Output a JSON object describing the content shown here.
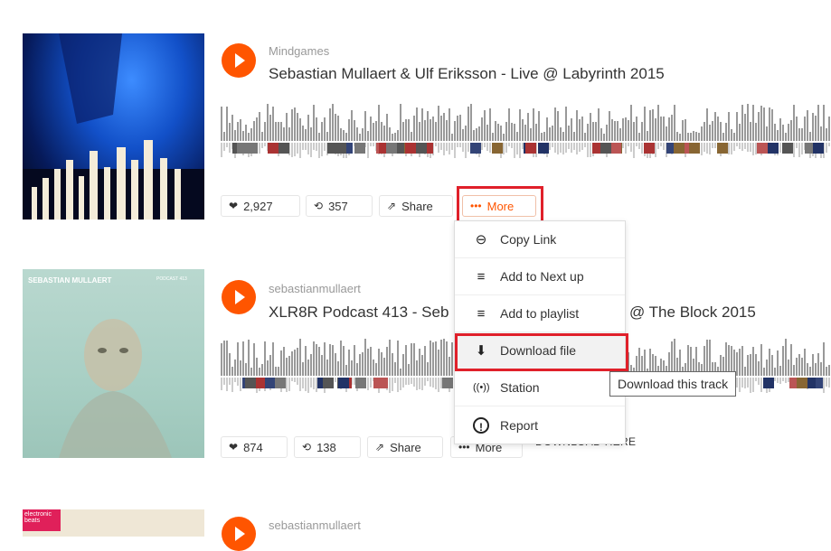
{
  "tracks": [
    {
      "user": "Mindgames",
      "title": "Sebastian Mullaert & Ulf Eriksson - Live @ Labyrinth 2015",
      "likes": "2,927",
      "reposts": "357",
      "share_label": "Share",
      "more_label": "More"
    },
    {
      "user": "sebastianmullaert",
      "title": "XLR8R Podcast 413 - Seb",
      "title_tail": "@ The Block 2015",
      "art_label": "SEBASTIAN MULLAERT",
      "art_badge": "PODCAST 413",
      "likes": "874",
      "reposts": "138",
      "share_label": "Share",
      "more_label": "More",
      "download_text": "DOWNLOAD HERE"
    },
    {
      "user": "sebastianmullaert",
      "art_label": "electronic beats"
    }
  ],
  "menu": {
    "items": [
      {
        "label": "Copy Link",
        "icon": "link-icon"
      },
      {
        "label": "Add to Next up",
        "icon": "add-next-icon"
      },
      {
        "label": "Add to playlist",
        "icon": "add-playlist-icon"
      },
      {
        "label": "Download file",
        "icon": "download-icon"
      },
      {
        "label": "Station",
        "icon": "station-icon"
      },
      {
        "label": "Report",
        "icon": "report-icon"
      }
    ]
  },
  "tooltip": "Download this track",
  "colors": {
    "accent": "#ff5500",
    "highlight_box": "#e0202a",
    "waveform": "#999999"
  }
}
